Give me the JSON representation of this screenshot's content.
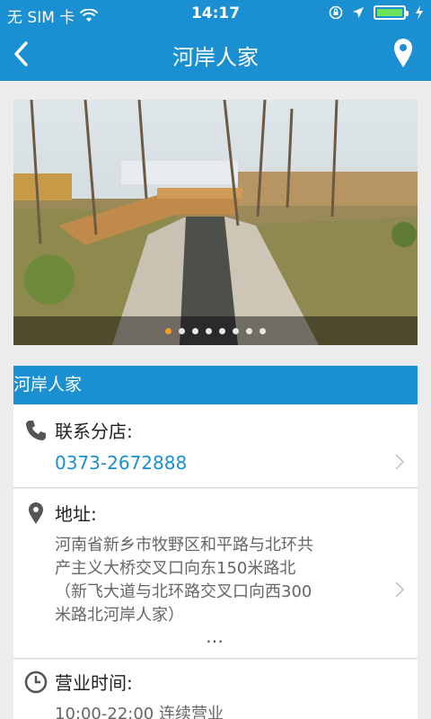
{
  "status_bar": {
    "carrier": "无 SIM 卡",
    "time": "14:17",
    "battery_level": 1.0
  },
  "nav": {
    "title": "河岸人家",
    "back_icon": "chevron-left-icon",
    "location_icon": "map-pin-icon"
  },
  "carousel": {
    "total_pages": 8,
    "active_index": 0
  },
  "section_header": "河岸人家",
  "contact": {
    "label": "联系分店:",
    "phone": "0373-2672888"
  },
  "address": {
    "label": "地址:",
    "line1": "河南省新乡市牧野区和平路与北环共",
    "line2": "产主义大桥交叉口向东150米路北",
    "line3": "（新飞大道与北环路交叉口向西300",
    "line4": "米路北河岸人家）",
    "more": "…"
  },
  "hours": {
    "label": "营业时间:",
    "value": "10:00-22:00 连续营业"
  },
  "colors": {
    "brand": "#1a8fd2",
    "active_dot": "#f29a2a"
  }
}
